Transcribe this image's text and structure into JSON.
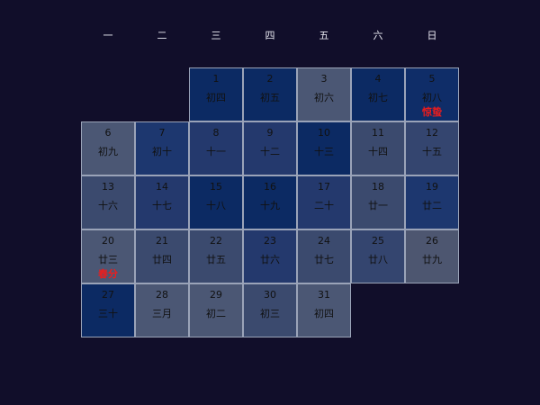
{
  "weekdays": [
    "一",
    "二",
    "三",
    "四",
    "五",
    "六",
    "日"
  ],
  "colors": {
    "background": "#110e2a",
    "festival_text": "#ee1c1c",
    "cell_border": "#9aa3b8"
  },
  "days": [
    {
      "num": "1",
      "lunar": "初四",
      "festival": "",
      "bg": "#0c2a63"
    },
    {
      "num": "2",
      "lunar": "初五",
      "festival": "",
      "bg": "#0c2a63"
    },
    {
      "num": "3",
      "lunar": "初六",
      "festival": "",
      "bg": "#4b5774"
    },
    {
      "num": "4",
      "lunar": "初七",
      "festival": "",
      "bg": "#0c2a63"
    },
    {
      "num": "5",
      "lunar": "初八",
      "festival": "惊蛰",
      "bg": "#0f2d68"
    },
    {
      "num": "6",
      "lunar": "初九",
      "festival": "",
      "bg": "#4b5774"
    },
    {
      "num": "7",
      "lunar": "初十",
      "festival": "",
      "bg": "#1d376f"
    },
    {
      "num": "8",
      "lunar": "十一",
      "festival": "",
      "bg": "#24396d"
    },
    {
      "num": "9",
      "lunar": "十二",
      "festival": "",
      "bg": "#24396d"
    },
    {
      "num": "10",
      "lunar": "十三",
      "festival": "",
      "bg": "#0c2a63"
    },
    {
      "num": "11",
      "lunar": "十四",
      "festival": "",
      "bg": "#3b4a6e"
    },
    {
      "num": "12",
      "lunar": "十五",
      "festival": "",
      "bg": "#34456f"
    },
    {
      "num": "13",
      "lunar": "十六",
      "festival": "",
      "bg": "#3b4a6e"
    },
    {
      "num": "14",
      "lunar": "十七",
      "festival": "",
      "bg": "#24396d"
    },
    {
      "num": "15",
      "lunar": "十八",
      "festival": "",
      "bg": "#0c2a63"
    },
    {
      "num": "16",
      "lunar": "十九",
      "festival": "",
      "bg": "#0c2a63"
    },
    {
      "num": "17",
      "lunar": "二十",
      "festival": "",
      "bg": "#24396d"
    },
    {
      "num": "18",
      "lunar": "廿一",
      "festival": "",
      "bg": "#3b4a6e"
    },
    {
      "num": "19",
      "lunar": "廿二",
      "festival": "",
      "bg": "#1d376f"
    },
    {
      "num": "20",
      "lunar": "廿三",
      "festival": "春分",
      "bg": "#4b5774"
    },
    {
      "num": "21",
      "lunar": "廿四",
      "festival": "",
      "bg": "#3b4a6e"
    },
    {
      "num": "22",
      "lunar": "廿五",
      "festival": "",
      "bg": "#3b4a6e"
    },
    {
      "num": "23",
      "lunar": "廿六",
      "festival": "",
      "bg": "#24396d"
    },
    {
      "num": "24",
      "lunar": "廿七",
      "festival": "",
      "bg": "#3b4a6e"
    },
    {
      "num": "25",
      "lunar": "廿八",
      "festival": "",
      "bg": "#34456f"
    },
    {
      "num": "26",
      "lunar": "廿九",
      "festival": "",
      "bg": "#4d5670"
    },
    {
      "num": "27",
      "lunar": "三十",
      "festival": "",
      "bg": "#0c2a63"
    },
    {
      "num": "28",
      "lunar": "三月",
      "festival": "",
      "bg": "#4b5774"
    },
    {
      "num": "29",
      "lunar": "初二",
      "festival": "",
      "bg": "#4b5774"
    },
    {
      "num": "30",
      "lunar": "初三",
      "festival": "",
      "bg": "#3b4a6e"
    },
    {
      "num": "31",
      "lunar": "初四",
      "festival": "",
      "bg": "#4b5774"
    }
  ]
}
